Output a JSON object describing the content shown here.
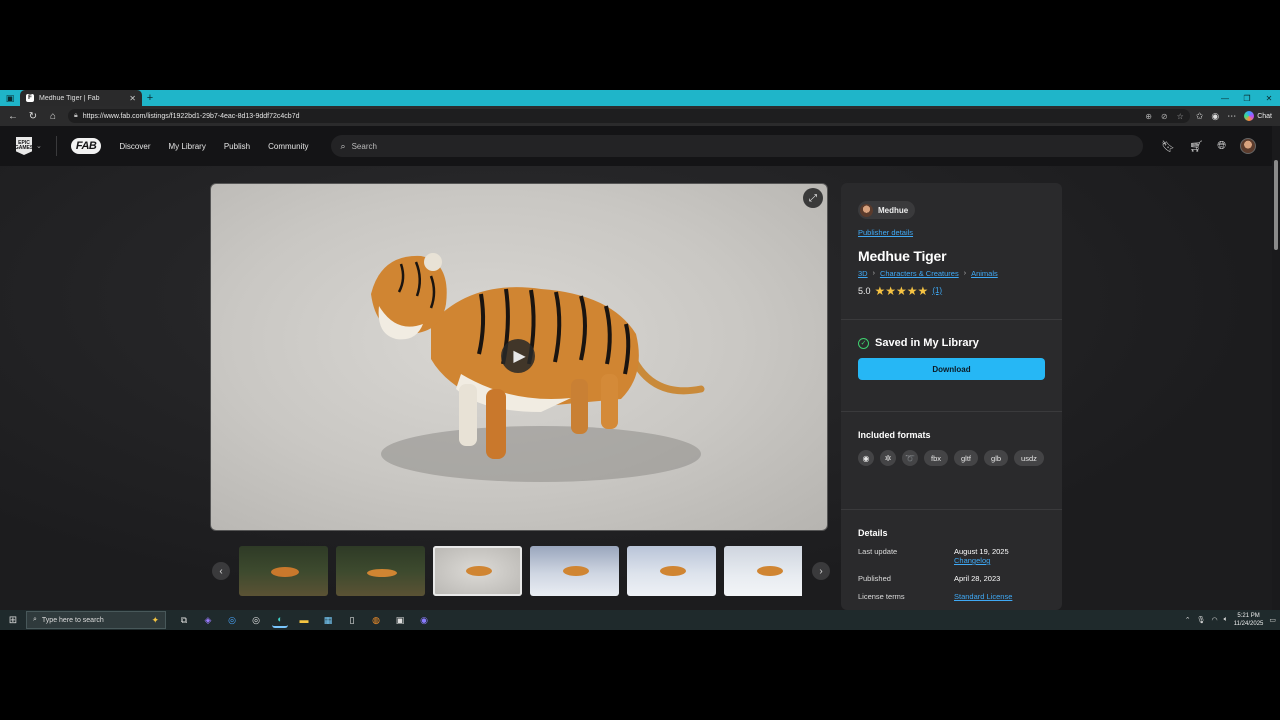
{
  "browser": {
    "tab_title": "Medhue Tiger | Fab",
    "tab_favicon": "F",
    "url": "https://www.fab.com/listings/f1922bd1-29b7-4eac-8d13-9ddf72c4cb7d",
    "chat_label": "Chat"
  },
  "site": {
    "brand_logo": "EPIC GAMES",
    "fab_logo": "FAB",
    "nav": [
      "Discover",
      "My Library",
      "Publish",
      "Community"
    ],
    "search_placeholder": "Search"
  },
  "listing": {
    "publisher": "Medhue",
    "publisher_details": "Publisher details",
    "title": "Medhue Tiger",
    "breadcrumbs": [
      "3D",
      "Characters & Creatures",
      "Animals"
    ],
    "rating": "5.0",
    "stars": "★★★★★",
    "rating_count": "(1)",
    "saved_label": "Saved in My Library",
    "download_label": "Download",
    "formats_title": "Included formats",
    "format_icons": [
      "unreal-engine-icon",
      "unity-icon",
      "blender-icon"
    ],
    "formats": [
      "fbx",
      "gltf",
      "glb",
      "usdz"
    ],
    "details_title": "Details",
    "details": [
      {
        "key": "Last update",
        "value": "August 19, 2025",
        "link": "Changelog"
      },
      {
        "key": "Published",
        "value": "April 28, 2023",
        "link": ""
      },
      {
        "key": "License terms",
        "value": "",
        "link": "Standard License"
      }
    ]
  },
  "taskbar": {
    "search_placeholder": "Type here to search",
    "time": "5:21 PM",
    "date": "11/24/2025"
  },
  "colors": {
    "accent": "#26b7f5",
    "link": "#3fa9f5",
    "star": "#f6c343",
    "success": "#3ecf6e",
    "tabstrip": "#1fb5c9"
  }
}
